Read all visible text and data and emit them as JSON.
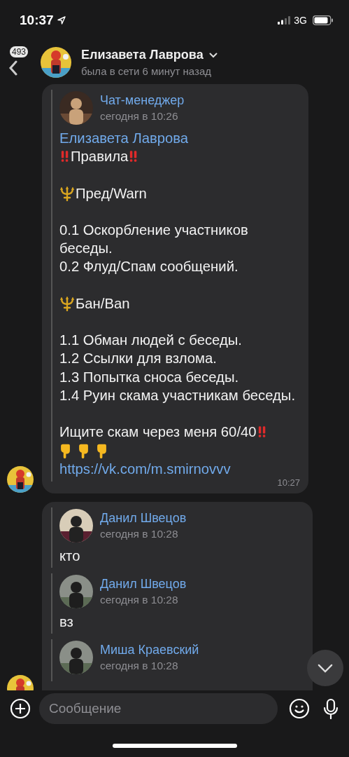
{
  "status_bar": {
    "time": "10:37",
    "network": "3G"
  },
  "header": {
    "back_count": "493",
    "name": "Елизавета Лаврова",
    "status": "была в сети 6 минут назад"
  },
  "messages": [
    {
      "time": "10:27",
      "forwards": [
        {
          "author": "Чат-менеджер",
          "date": "сегодня в 10:26",
          "lines": [
            {
              "kind": "mention",
              "text": "Елизавета Лаврова"
            },
            {
              "kind": "alert-title",
              "text": "Правила"
            },
            {
              "kind": "blank"
            },
            {
              "kind": "section",
              "text": "Пред/Warn"
            },
            {
              "kind": "blank"
            },
            {
              "kind": "plain",
              "text": "0.1 Оскорбление участников беседы."
            },
            {
              "kind": "plain",
              "text": "0.2 Флуд/Спам сообщений."
            },
            {
              "kind": "blank"
            },
            {
              "kind": "section",
              "text": "Бан/Ban"
            },
            {
              "kind": "blank"
            },
            {
              "kind": "plain",
              "text": "1.1 Обман людей с беседы."
            },
            {
              "kind": "plain",
              "text": "1.2 Ссылки для взлома."
            },
            {
              "kind": "plain",
              "text": "1.3 Попытка сноса беседы."
            },
            {
              "kind": "plain",
              "text": "1.4 Руин скама участникам беседы."
            },
            {
              "kind": "blank"
            },
            {
              "kind": "alert-end",
              "text": "Ищите скам через меня 60/40"
            },
            {
              "kind": "hands"
            },
            {
              "kind": "link",
              "text": "https://vk.com/m.smirnovvv"
            }
          ]
        }
      ]
    },
    {
      "forwards": [
        {
          "author": "Данил Швецов",
          "date": "сегодня в 10:28",
          "lines": [
            {
              "kind": "plain",
              "text": "кто"
            }
          ]
        },
        {
          "author": "Данил Швецов",
          "date": "сегодня в 10:28",
          "lines": [
            {
              "kind": "plain",
              "text": "вз"
            }
          ]
        },
        {
          "author": "Миша Краевский",
          "date": "сегодня в 10:28"
        }
      ]
    }
  ],
  "composer": {
    "placeholder": "Сообщение"
  }
}
